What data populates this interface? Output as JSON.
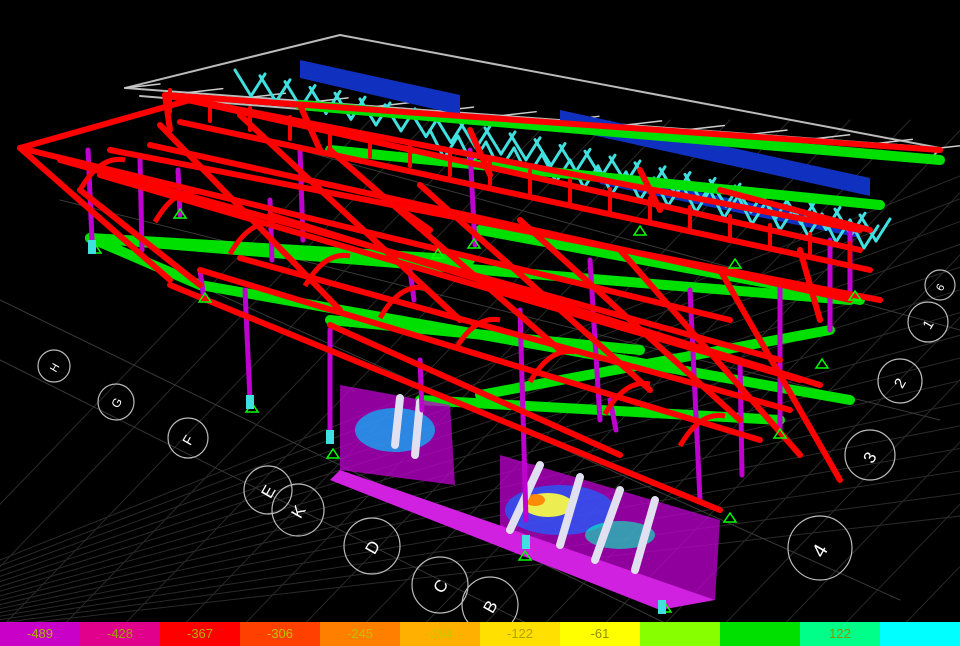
{
  "viewport": {
    "background": "#000000",
    "grid_labels": [
      "B",
      "C",
      "D",
      "K",
      "E",
      "F",
      "G",
      "H",
      "1",
      "2",
      "3",
      "4",
      "6"
    ]
  },
  "legend": {
    "segments": [
      {
        "color": "#c800c8",
        "label": "-489",
        "label_color": "#b0b000"
      },
      {
        "color": "#e0008c",
        "label": "-428",
        "label_color": "#a0a000"
      },
      {
        "color": "#ff0000",
        "label": "-367",
        "label_color": "#b0b000"
      },
      {
        "color": "#ff4000",
        "label": "-306",
        "label_color": "#c0c000"
      },
      {
        "color": "#ff8000",
        "label": "-245",
        "label_color": "#c0c000"
      },
      {
        "color": "#ffb000",
        "label": "-184",
        "label_color": "#c8c800"
      },
      {
        "color": "#ffe000",
        "label": "-122",
        "label_color": "#b4a000"
      },
      {
        "color": "#ffff00",
        "label": "-61",
        "label_color": "#909000"
      },
      {
        "color": "#88ff00",
        "label": "",
        "label_color": "#909000"
      },
      {
        "color": "#00e000",
        "label": "",
        "label_color": "#909000"
      },
      {
        "color": "#00ff88",
        "label": "122",
        "label_color": "#909000"
      },
      {
        "color": "#00ffff",
        "label": "",
        "label_color": "#909000"
      }
    ]
  },
  "colors": {
    "beam": "#ff0000",
    "column": "#c000d0",
    "ground_beam": "#00e000",
    "truss": "#40e0e0",
    "roof_slab": "#1030c0",
    "grid_line": "#666666",
    "support": "#00ff00"
  }
}
